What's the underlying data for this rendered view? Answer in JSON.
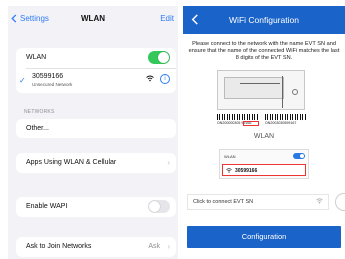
{
  "settings": {
    "nav": {
      "back_label": "Settings",
      "title": "WLAN",
      "edit_label": "Edit"
    },
    "wlan_toggle": {
      "label": "WLAN",
      "on": true
    },
    "current_network": {
      "name": "30599166",
      "status": "Unsecured Network"
    },
    "networks_header": "NETWORKS",
    "other_label": "Other...",
    "apps_label": "Apps Using WLAN & Cellular",
    "wapi": {
      "label": "Enable WAPI",
      "on": false
    },
    "ask_join": {
      "label": "Ask to Join Networks",
      "value": "Ask"
    },
    "colors": {
      "accent": "#2f7cf6",
      "toggle_on": "#34c759",
      "toggle_off": "#e5e5ea"
    }
  },
  "app": {
    "title": "WiFi Configuration",
    "instructions": "Please connect to the network with the name EVT SN and ensure that the name of the connected WiFi matches the last 8 digits of the EVT SN.",
    "illustration": {
      "barcode_left_text": "ON200000305 99166",
      "barcode_right_text": "ON2003030599167",
      "wlan_caption": "WLAN",
      "mini_label": "WLAN",
      "mini_ssid": "30599166"
    },
    "connect_placeholder": "Click to connect EVT SN",
    "button_label": "Configuration",
    "colors": {
      "primary": "#1a63c9"
    }
  }
}
